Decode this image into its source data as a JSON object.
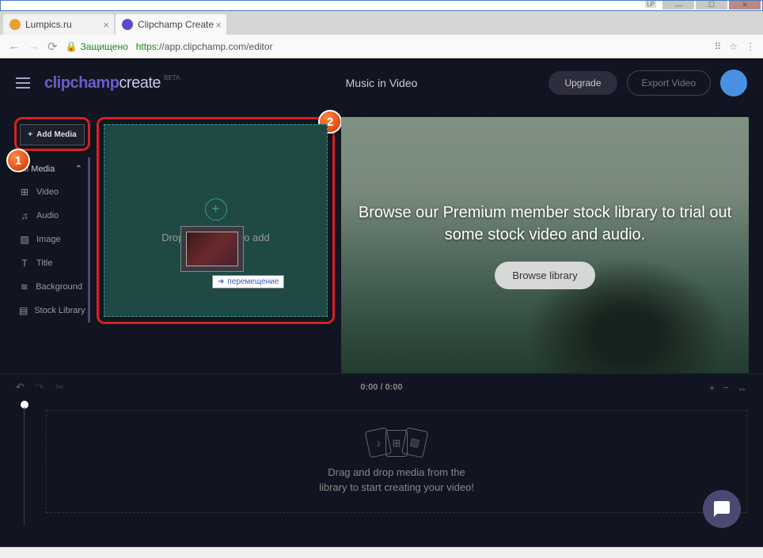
{
  "window": {
    "lp": "LP"
  },
  "tabs": [
    {
      "label": "Lumpics.ru",
      "favColor": "#e8a030"
    },
    {
      "label": "Clipchamp Create",
      "favColor": "#5a4acc"
    }
  ],
  "urlbar": {
    "secure_label": "Защищено",
    "https": "https",
    "rest": "://app.clipchamp.com/editor"
  },
  "logo": {
    "p1": "clipchamp",
    "p2": "create",
    "beta": "BETA"
  },
  "project_title": "Music in Video",
  "buttons": {
    "upgrade": "Upgrade",
    "export": "Export Video",
    "add_media": "Add Media",
    "browse_library": "Browse library"
  },
  "sidebar": {
    "head": "All Media",
    "items": [
      {
        "icon": "⊞",
        "label": "Video"
      },
      {
        "icon": "♫",
        "label": "Audio"
      },
      {
        "icon": "▨",
        "label": "Image"
      },
      {
        "icon": "T",
        "label": "Title"
      },
      {
        "icon": "≋",
        "label": "Background"
      },
      {
        "icon": "▤",
        "label": "Stock Library"
      }
    ]
  },
  "dropzone": {
    "text": "Drop media here to add",
    "drag_label": "перемещение"
  },
  "promo": {
    "line": "Browse our Premium member stock library to trial out some stock video and audio."
  },
  "timeline": {
    "time": "0:00 / 0:00",
    "hint1": "Drag and drop media from the",
    "hint2": "library to start creating your video!"
  },
  "badges": {
    "one": "1",
    "two": "2"
  }
}
